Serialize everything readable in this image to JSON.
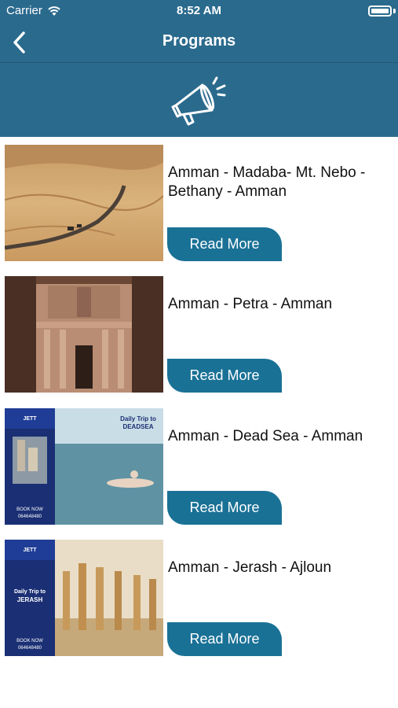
{
  "status_bar": {
    "carrier": "Carrier",
    "time": "8:52 AM"
  },
  "nav": {
    "title": "Programs",
    "back_icon": "chevron-left-icon"
  },
  "banner": {
    "icon": "megaphone-icon"
  },
  "colors": {
    "header": "#2a6a8d",
    "button": "#1a7196"
  },
  "programs": [
    {
      "title": "Amman - Madaba- Mt. Nebo - Bethany - Amman",
      "button": "Read More",
      "image": "desert-road-photo"
    },
    {
      "title": "Amman - Petra - Amman",
      "button": "Read More",
      "image": "petra-treasury-photo"
    },
    {
      "title": "Amman - Dead Sea - Amman",
      "button": "Read More",
      "image": "deadsea-flyer",
      "flyer": {
        "heading": "Daily Trip to",
        "place": "DEADSEA",
        "book": "BOOK NOW",
        "phone": "064648480"
      }
    },
    {
      "title": "Amman - Jerash - Ajloun",
      "button": "Read More",
      "image": "jerash-flyer",
      "flyer": {
        "heading": "Daily Trip to",
        "place": "JERASH",
        "book": "BOOK NOW",
        "phone": "064648480"
      }
    }
  ]
}
